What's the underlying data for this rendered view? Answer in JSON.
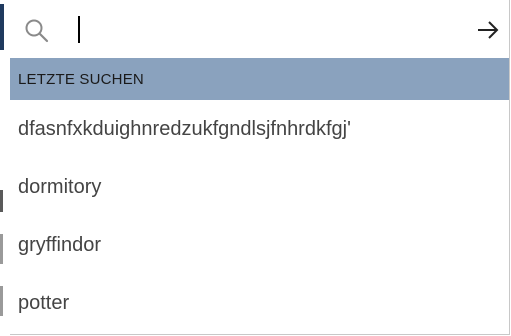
{
  "search": {
    "value": "",
    "placeholder": ""
  },
  "icons": {
    "search": "search-icon",
    "submit": "arrow-right-icon"
  },
  "recent": {
    "header": "LETZTE SUCHEN",
    "items": [
      "dfasnfxkduighnredzukfgndlsjfnhrdkfgj'",
      "dormitory",
      "gryffindor",
      "potter"
    ]
  },
  "colors": {
    "header_bg": "#8aa2be",
    "item_text": "#444444",
    "edge_blue": "#1f3a5f"
  }
}
